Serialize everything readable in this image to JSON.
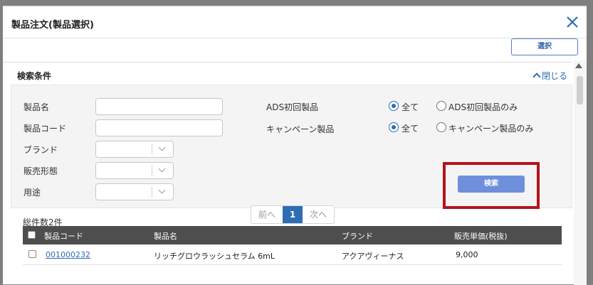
{
  "dialog": {
    "title": "製品注文(製品選択)",
    "select_button": "選択",
    "section_title": "検索条件",
    "collapse_label": "閉じる"
  },
  "form": {
    "product_name_label": "製品名",
    "product_code_label": "製品コード",
    "brand_label": "ブランド",
    "sales_form_label": "販売形態",
    "usage_label": "用途",
    "product_name_value": "",
    "product_code_value": "",
    "ads_label": "ADS初回製品",
    "ads_all": "全て",
    "ads_only": "ADS初回製品のみ",
    "campaign_label": "キャンペーン製品",
    "campaign_all": "全て",
    "campaign_only": "キャンペーン製品のみ",
    "search_button": "検索"
  },
  "pager": {
    "prev": "前へ",
    "current": "1",
    "next": "次へ"
  },
  "results": {
    "total": "総件数2件",
    "columns": [
      "製品コード",
      "製品名",
      "ブランド",
      "販売単価(税抜)"
    ],
    "rows": [
      {
        "code": "001000232",
        "name": "リッチグロウラッシュセラム 6mL",
        "brand": "アクアヴィーナス",
        "price": "9,000"
      }
    ]
  },
  "colors": {
    "accent": "#2e6db3",
    "search_button": "#6f8fdc",
    "highlight": "#b5121b",
    "table_header": "#4e4e4e"
  }
}
